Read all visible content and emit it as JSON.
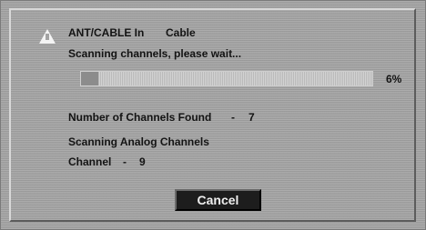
{
  "header": {
    "input_label": "ANT/CABLE In",
    "input_value": "Cable"
  },
  "status": {
    "scanning_message": "Scanning channels, please wait..."
  },
  "progress": {
    "percent_label": "6%",
    "fraction": 0.06
  },
  "results": {
    "channels_found_label": "Number of Channels Found",
    "channels_found_separator": "-",
    "channels_found_value": "7",
    "scan_type": "Scanning Analog Channels",
    "channel_label": "Channel",
    "channel_separator": "-",
    "channel_value": "9"
  },
  "actions": {
    "cancel_label": "Cancel"
  },
  "icons": {
    "warning": "warning-triangle-icon"
  },
  "colors": {
    "dialog_background": "#a3a3a3",
    "text": "#141414",
    "button_background": "#1d1d1d",
    "button_text": "#efefef"
  }
}
